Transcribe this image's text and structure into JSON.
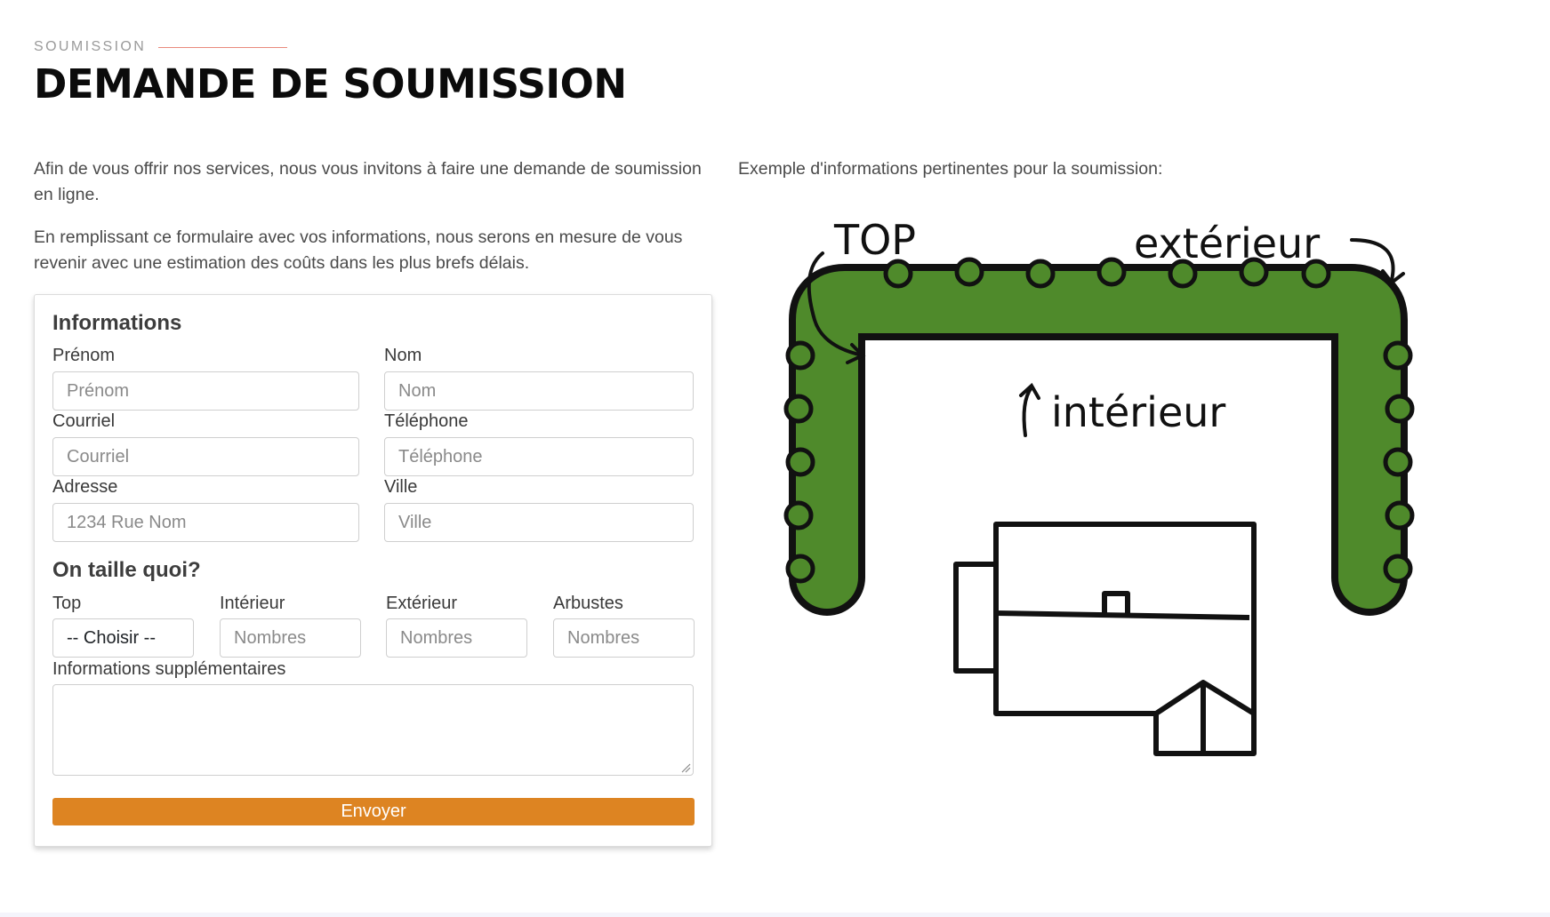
{
  "header": {
    "eyebrow": "SOUMISSION",
    "title": "DEMANDE DE SOUMISSION"
  },
  "intro": {
    "paragraph_1": "Afin de vous offrir nos services, nous vous invitons à faire une demande de soumission en ligne.",
    "paragraph_2": "En remplissant ce formulaire avec vos informations, nous serons en mesure de vous revenir avec une estimation des coûts dans les plus brefs délais."
  },
  "example": {
    "caption": "Exemple d'informations pertinentes pour la soumission:",
    "labels": {
      "top": "TOP",
      "exterieur": "extérieur",
      "interieur": "intérieur"
    },
    "colors": {
      "hedge": "#4f8a2b",
      "outline": "#111111"
    }
  },
  "form": {
    "section_1_title": "Informations",
    "fields": {
      "prenom": {
        "label": "Prénom",
        "placeholder": "Prénom"
      },
      "nom": {
        "label": "Nom",
        "placeholder": "Nom"
      },
      "courriel": {
        "label": "Courriel",
        "placeholder": "Courriel"
      },
      "telephone": {
        "label": "Téléphone",
        "placeholder": "Téléphone"
      },
      "adresse": {
        "label": "Adresse",
        "placeholder": "1234 Rue Nom"
      },
      "ville": {
        "label": "Ville",
        "placeholder": "Ville"
      }
    },
    "section_2_title": "On taille quoi?",
    "trim": {
      "top": {
        "label": "Top",
        "selected": "-- Choisir --"
      },
      "interieur": {
        "label": "Intérieur",
        "placeholder": "Nombres"
      },
      "exterieur": {
        "label": "Extérieur",
        "placeholder": "Nombres"
      },
      "arbustes": {
        "label": "Arbustes",
        "placeholder": "Nombres"
      }
    },
    "extra": {
      "label": "Informations supplémentaires"
    },
    "submit_label": "Envoyer",
    "accent_color": "#dd8422"
  }
}
